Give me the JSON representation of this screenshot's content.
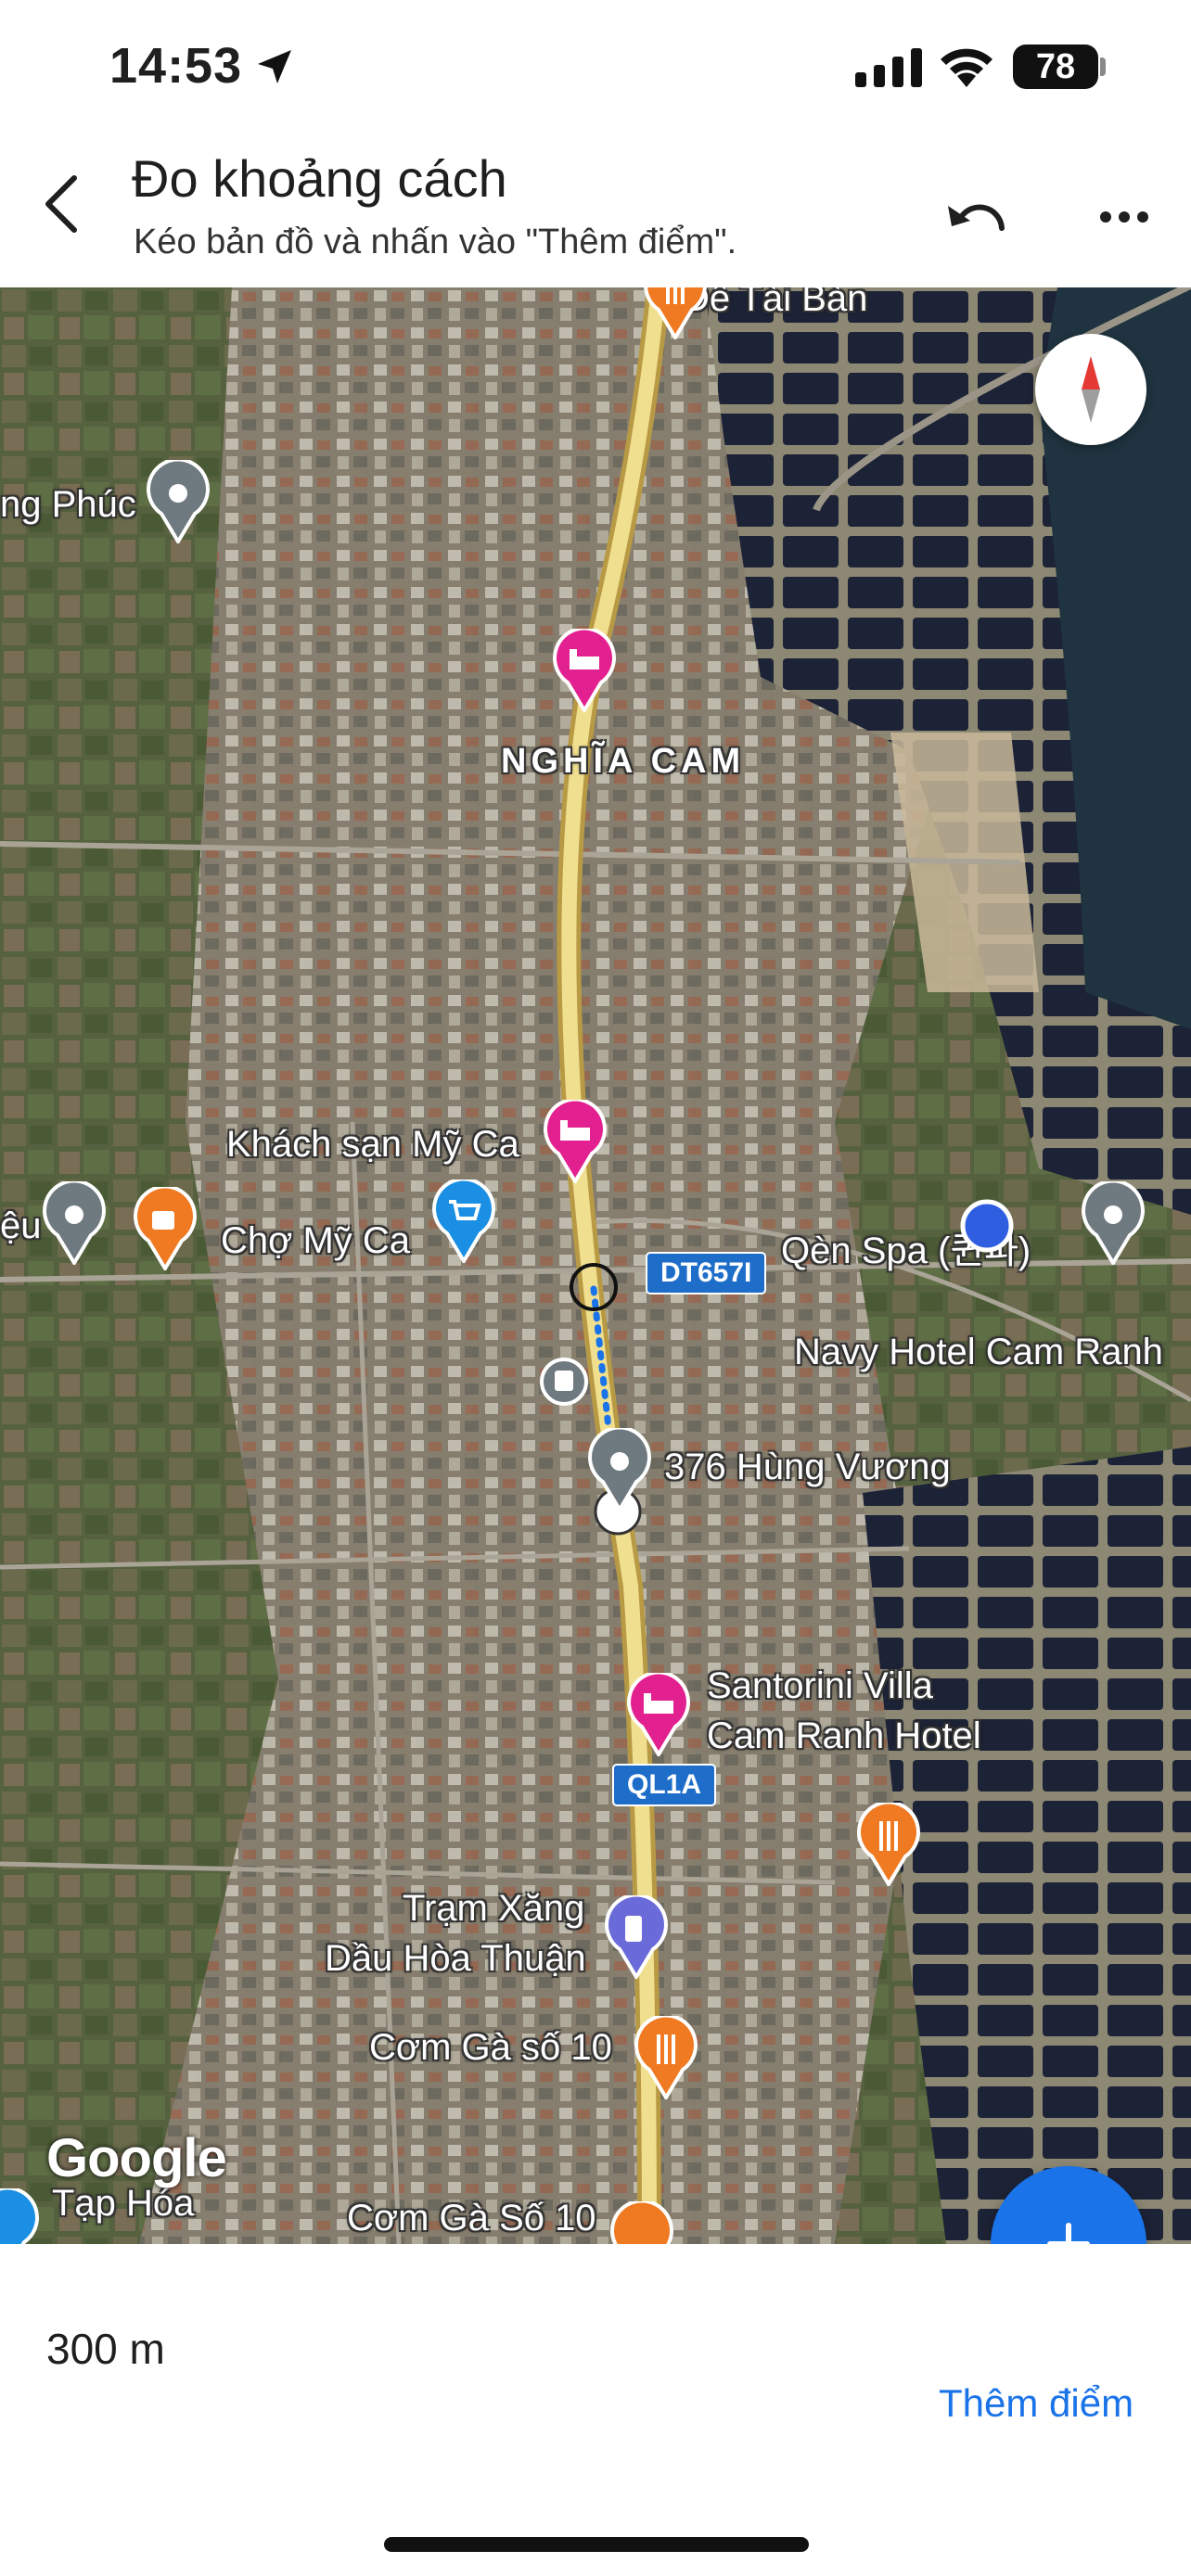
{
  "status_bar": {
    "time": "14:53",
    "battery": "78"
  },
  "header": {
    "title": "Đo khoảng cách",
    "subtitle": "Kéo bản đồ và nhấn vào \"Thêm điểm\".",
    "back_icon": "chevron-left-icon",
    "undo_icon": "undo-icon",
    "more_icon": "more-horizontal-icon"
  },
  "map": {
    "labels": {
      "de_tai_ban": "Dê Tài Bàn",
      "hung_phuc": "ng Phúc",
      "nghia_cam": "NGHĨA CAM",
      "khach_san_my_ca": "Khách sạn Mỹ Ca",
      "cho_my_ca": "Chợ Mỹ Ca",
      "eu": "ệu",
      "qen_spa": "Qèn Spa (퀸파)",
      "navy_hotel": "Navy Hotel Cam Ranh",
      "hung_vuong": "376 Hùng Vương",
      "santorini_1": "Santorini Villa",
      "santorini_2": "Cam Ranh Hotel",
      "tram_xang_1": "Trạm Xăng",
      "tram_xang_2": "Dầu Hòa Thuận",
      "com_ga_so_10_a": "Cơm Gà số 10",
      "com_ga_so_10_b": "Cơm Gà Số 10",
      "tap_hoa": "Tạp Hóa",
      "google": "Google"
    },
    "road_shields": {
      "dt657i": "DT657I",
      "ql1a": "QL1A"
    },
    "colors": {
      "hotel_pin": "#e3208f",
      "food_pin": "#f07a22",
      "shop_pin": "#1a8fe3",
      "place_pin": "#6f7a80",
      "gas_pin": "#6a6bd8",
      "road": "#f0df8f"
    }
  },
  "bottom": {
    "distance": "300 m",
    "add_point": "Thêm điểm",
    "fab_icon": "plus-icon"
  }
}
